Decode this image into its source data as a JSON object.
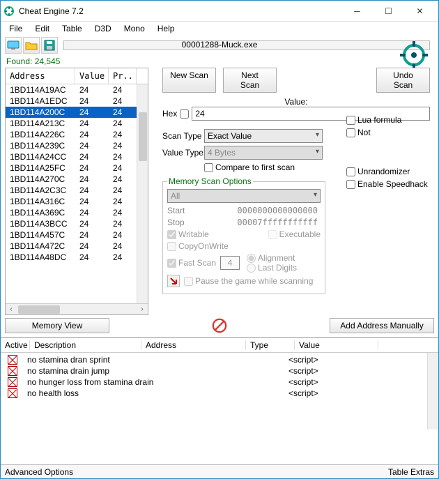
{
  "window": {
    "title": "Cheat Engine 7.2",
    "process": "00001288-Muck.exe",
    "found_label": "Found:",
    "found_count": "24,545"
  },
  "menu": {
    "items": [
      "File",
      "Edit",
      "Table",
      "D3D",
      "Mono",
      "Help"
    ]
  },
  "toolbar": {
    "settings_label": "Settings"
  },
  "results": {
    "headers": {
      "address": "Address",
      "value": "Value",
      "previous": "Pr.."
    },
    "rows": [
      {
        "addr": "1BD114A19AC",
        "val": "24",
        "prev": "24",
        "sel": false
      },
      {
        "addr": "1BD114A1EDC",
        "val": "24",
        "prev": "24",
        "sel": false
      },
      {
        "addr": "1BD114A200C",
        "val": "24",
        "prev": "24",
        "sel": true
      },
      {
        "addr": "1BD114A213C",
        "val": "24",
        "prev": "24",
        "sel": false
      },
      {
        "addr": "1BD114A226C",
        "val": "24",
        "prev": "24",
        "sel": false
      },
      {
        "addr": "1BD114A239C",
        "val": "24",
        "prev": "24",
        "sel": false
      },
      {
        "addr": "1BD114A24CC",
        "val": "24",
        "prev": "24",
        "sel": false
      },
      {
        "addr": "1BD114A25FC",
        "val": "24",
        "prev": "24",
        "sel": false
      },
      {
        "addr": "1BD114A270C",
        "val": "24",
        "prev": "24",
        "sel": false
      },
      {
        "addr": "1BD114A2C3C",
        "val": "24",
        "prev": "24",
        "sel": false
      },
      {
        "addr": "1BD114A316C",
        "val": "24",
        "prev": "24",
        "sel": false
      },
      {
        "addr": "1BD114A369C",
        "val": "24",
        "prev": "24",
        "sel": false
      },
      {
        "addr": "1BD114A3BCC",
        "val": "24",
        "prev": "24",
        "sel": false
      },
      {
        "addr": "1BD114A457C",
        "val": "24",
        "prev": "24",
        "sel": false
      },
      {
        "addr": "1BD114A472C",
        "val": "24",
        "prev": "24",
        "sel": false
      },
      {
        "addr": "1BD114A48DC",
        "val": "24",
        "prev": "24",
        "sel": false
      }
    ]
  },
  "scan": {
    "new_scan": "New Scan",
    "next_scan": "Next Scan",
    "undo_scan": "Undo Scan",
    "value_label": "Value:",
    "hex_label": "Hex",
    "value_input": "24",
    "scan_type_label": "Scan Type",
    "scan_type_value": "Exact Value",
    "value_type_label": "Value Type",
    "value_type_value": "4 Bytes",
    "compare_first": "Compare to first scan",
    "lua_formula": "Lua formula",
    "not": "Not",
    "unrandomizer": "Unrandomizer",
    "enable_speedhack": "Enable Speedhack"
  },
  "mem_opts": {
    "legend": "Memory Scan Options",
    "preset": "All",
    "start_label": "Start",
    "start_value": "0000000000000000",
    "stop_label": "Stop",
    "stop_value": "00007fffffffffff",
    "writable": "Writable",
    "executable": "Executable",
    "copyonwrite": "CopyOnWrite",
    "fastscan": "Fast Scan",
    "fastscan_value": "4",
    "alignment": "Alignment",
    "lastdigits": "Last Digits",
    "pause": "Pause the game while scanning"
  },
  "buttons": {
    "memory_view": "Memory View",
    "add_manually": "Add Address Manually"
  },
  "cheat_table": {
    "headers": {
      "active": "Active",
      "desc": "Description",
      "address": "Address",
      "type": "Type",
      "value": "Value"
    },
    "rows": [
      {
        "desc": "no stamina dran sprint",
        "value": "<script>"
      },
      {
        "desc": "no stamina drain jump",
        "value": "<script>"
      },
      {
        "desc": "no hunger loss from stamina drain",
        "value": "<script>"
      },
      {
        "desc": "no health loss",
        "value": "<script>"
      }
    ]
  },
  "statusbar": {
    "advanced": "Advanced Options",
    "extras": "Table Extras"
  }
}
